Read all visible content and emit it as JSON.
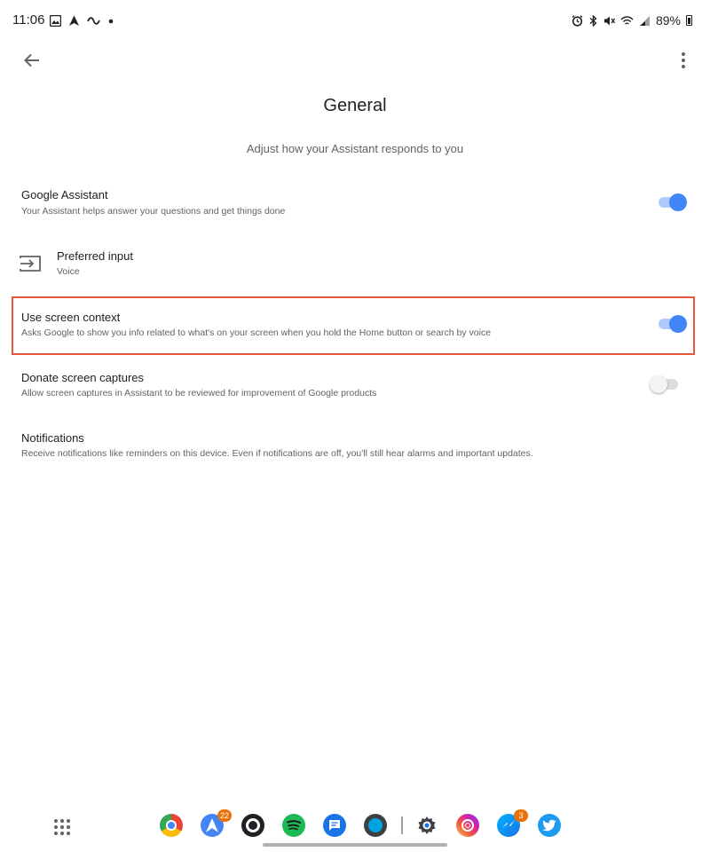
{
  "status_bar": {
    "time": "11:06",
    "left_icons": [
      "image-icon",
      "navigation-arrow-icon",
      "link-icon",
      "dot-icon"
    ],
    "right_icons": [
      "alarm-icon",
      "bluetooth-icon",
      "mute-icon",
      "wifi-icon",
      "signal-icon"
    ],
    "battery": "89%"
  },
  "header": {
    "back_icon": "arrow-back-icon",
    "more_icon": "more-vert-icon",
    "title": "General",
    "subtitle": "Adjust how your Assistant responds to you"
  },
  "settings": {
    "google_assistant": {
      "title": "Google Assistant",
      "subtitle": "Your Assistant helps answer your questions and get things done",
      "enabled": true
    },
    "preferred_input": {
      "title": "Preferred input",
      "subtitle": "Voice",
      "icon": "input-icon"
    },
    "use_screen_context": {
      "title": "Use screen context",
      "subtitle": "Asks Google to show you info related to what's on your screen when you hold the Home button or search by voice",
      "enabled": true,
      "highlight_color": "#e8573a"
    },
    "donate_screen_captures": {
      "title": "Donate screen captures",
      "subtitle": "Allow screen captures in Assistant to be reviewed for improvement of Google products",
      "enabled": false
    },
    "notifications": {
      "title": "Notifications",
      "subtitle": "Receive notifications like reminders on this device. Even if notifications are off, you'll still hear alarms and important updates."
    }
  },
  "taskbar": {
    "apps_icon": "apps-grid-icon",
    "apps": [
      {
        "name": "chrome-icon",
        "badge": ""
      },
      {
        "name": "spark-mail-icon",
        "badge": "22"
      },
      {
        "name": "beeper-icon",
        "badge": ""
      },
      {
        "name": "spotify-icon",
        "badge": ""
      },
      {
        "name": "messages-icon",
        "badge": ""
      },
      {
        "name": "camera-app-icon",
        "badge": ""
      },
      {
        "name": "settings-icon",
        "badge": ""
      },
      {
        "name": "instagram-icon",
        "badge": ""
      },
      {
        "name": "messenger-icon",
        "badge": "3"
      },
      {
        "name": "twitter-icon",
        "badge": ""
      }
    ],
    "colors": {
      "accent_blue": "#4285f4",
      "spotify": "#1db954",
      "instagram": "#d6249f",
      "twitter": "#1d9bf0",
      "badge": "#e8710a"
    }
  }
}
